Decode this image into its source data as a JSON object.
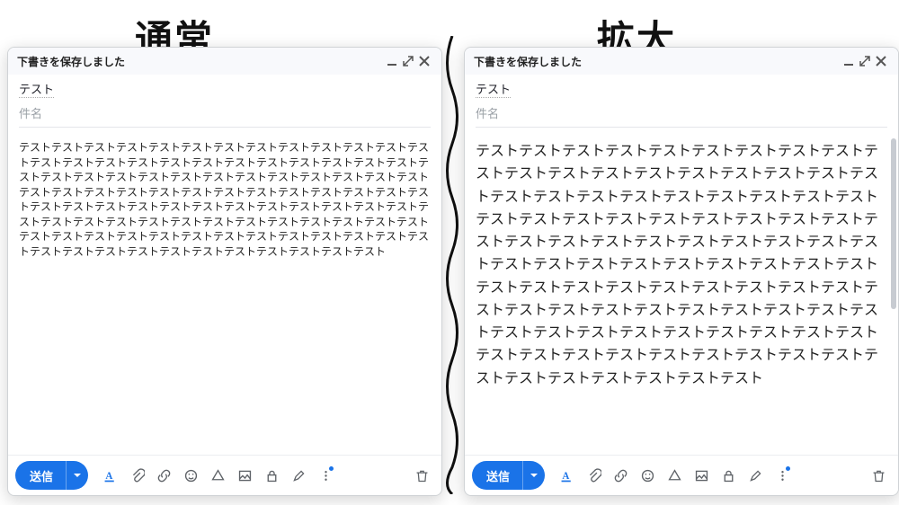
{
  "annotation": {
    "left": "通常",
    "right": "拡大"
  },
  "common": {
    "window_title": "下書きを保存しました",
    "to_value": "テスト",
    "subject_placeholder": "件名",
    "body_unit": "テスト",
    "body_repeat": 100,
    "send_label": "送信"
  },
  "icons": {
    "minimize": "minimize",
    "expand": "expand",
    "close": "close",
    "format": "format-A",
    "attach": "paperclip",
    "link": "link",
    "emoji": "smiley",
    "drive": "drive-triangle",
    "photo": "photo",
    "lock": "lock",
    "pen": "pen",
    "more": "more",
    "trash": "trash",
    "dropdown": "caret-down"
  }
}
